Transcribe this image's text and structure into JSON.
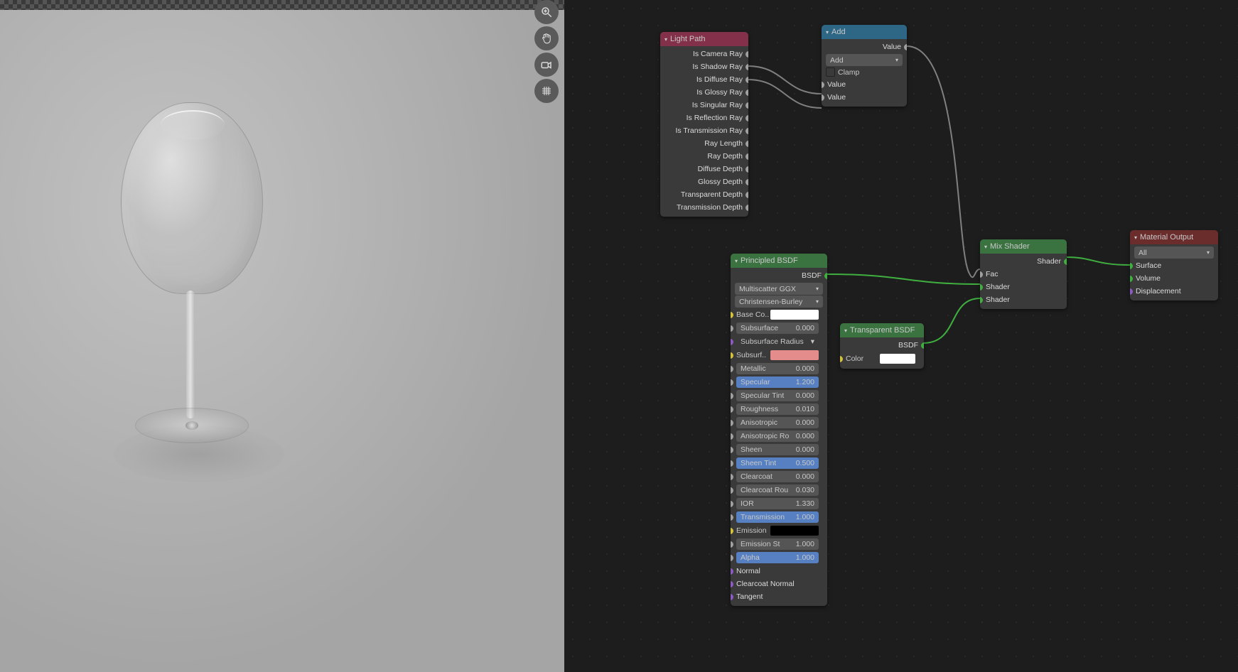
{
  "viewport": {
    "tools": {
      "zoom": "zoom",
      "pan": "pan",
      "camera": "camera",
      "grid": "grid"
    }
  },
  "nodes": {
    "lightPath": {
      "title": "Light Path",
      "outputs": [
        "Is Camera Ray",
        "Is Shadow Ray",
        "Is Diffuse Ray",
        "Is Glossy Ray",
        "Is Singular Ray",
        "Is Reflection Ray",
        "Is Transmission Ray",
        "Ray Length",
        "Ray Depth",
        "Diffuse Depth",
        "Glossy Depth",
        "Transparent Depth",
        "Transmission Depth"
      ]
    },
    "add": {
      "title": "Add",
      "output": "Value",
      "operation": "Add",
      "clamp": "Clamp",
      "inputs": [
        "Value",
        "Value"
      ]
    },
    "principled": {
      "title": "Principled BSDF",
      "output": "BSDF",
      "distribution": "Multiscatter GGX",
      "subsurfaceMethod": "Christensen-Burley",
      "baseColor": {
        "label": "Base Co..",
        "hex": "#ffffff"
      },
      "subsurfaceColor": {
        "label": "Subsurf..",
        "hex": "#e48c8c"
      },
      "props": [
        {
          "name": "Subsurface",
          "value": "0.000",
          "blue": false
        },
        {
          "name": "Subsurface Radius",
          "value": "",
          "blue": false,
          "dd": true
        },
        {
          "name": "Metallic",
          "value": "0.000",
          "blue": false
        },
        {
          "name": "Specular",
          "value": "1.200",
          "blue": true
        },
        {
          "name": "Specular Tint",
          "value": "0.000",
          "blue": false
        },
        {
          "name": "Roughness",
          "value": "0.010",
          "blue": false
        },
        {
          "name": "Anisotropic",
          "value": "0.000",
          "blue": false
        },
        {
          "name": "Anisotropic Ro",
          "value": "0.000",
          "blue": false
        },
        {
          "name": "Sheen",
          "value": "0.000",
          "blue": false
        },
        {
          "name": "Sheen Tint",
          "value": "0.500",
          "blue": true
        },
        {
          "name": "Clearcoat",
          "value": "0.000",
          "blue": false
        },
        {
          "name": "Clearcoat Rou",
          "value": "0.030",
          "blue": false
        },
        {
          "name": "IOR",
          "value": "1.330",
          "blue": false
        },
        {
          "name": "Transmission",
          "value": "1.000",
          "blue": true
        },
        {
          "name": "Emission St",
          "value": "1.000",
          "blue": false
        },
        {
          "name": "Alpha",
          "value": "1.000",
          "blue": true
        }
      ],
      "emission": {
        "label": "Emission",
        "hex": "#000000"
      },
      "vectorInputs": [
        "Normal",
        "Clearcoat Normal",
        "Tangent"
      ]
    },
    "transparent": {
      "title": "Transparent BSDF",
      "output": "BSDF",
      "color": {
        "label": "Color",
        "hex": "#ffffff"
      }
    },
    "mix": {
      "title": "Mix Shader",
      "output": "Shader",
      "inputs": [
        "Fac",
        "Shader",
        "Shader"
      ]
    },
    "materialOutput": {
      "title": "Material Output",
      "target": "All",
      "inputs": [
        "Surface",
        "Volume",
        "Displacement"
      ]
    }
  }
}
